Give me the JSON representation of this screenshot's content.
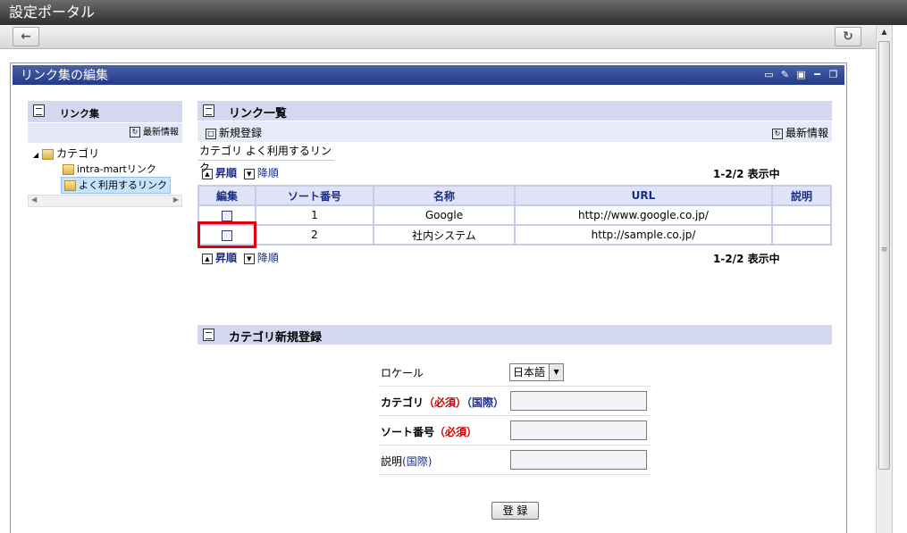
{
  "window": {
    "title": "設定ポータル"
  },
  "nav": {
    "back_icon": "back-arrow-icon",
    "refresh_icon": "refresh-icon"
  },
  "portlet": {
    "title": "リンク集の編集",
    "icons": [
      "monitor-icon",
      "pencil-icon",
      "settings-icon",
      "minimize-icon",
      "restore-icon"
    ]
  },
  "tree": {
    "header": "リンク集",
    "refresh_label": "最新情報",
    "root": "カテゴリ",
    "children": [
      "intra-martリンク",
      "よく利用するリンク"
    ],
    "selected": "よく利用するリンク"
  },
  "list": {
    "header": "リンク一覧",
    "new_label": "新規登録",
    "refresh_label": "最新情報",
    "category_path": "カテゴリ よく利用するリンク",
    "asc_label": "昇順",
    "desc_label": "降順",
    "count": "1-2/2 表示中",
    "columns": [
      "編集",
      "ソート番号",
      "名称",
      "URL",
      "説明"
    ],
    "rows": [
      {
        "sort": "1",
        "name": "Google",
        "url": "http://www.google.co.jp/",
        "desc": ""
      },
      {
        "sort": "2",
        "name": "社内システム",
        "url": "http://sample.co.jp/",
        "desc": ""
      }
    ]
  },
  "category_form": {
    "header": "カテゴリ新規登録",
    "locale_label": "ロケール",
    "locale_value": "日本語",
    "category_label": "カテゴリ",
    "sort_label": "ソート番号",
    "desc_label": "説明",
    "required": "（必須）",
    "intl": "（国際）",
    "intl_plain": "(国際)",
    "submit": "登 録"
  },
  "colors": {
    "header_bg": "#d4d8ef",
    "title_bar": "#23398a",
    "highlight": "#e00010"
  }
}
